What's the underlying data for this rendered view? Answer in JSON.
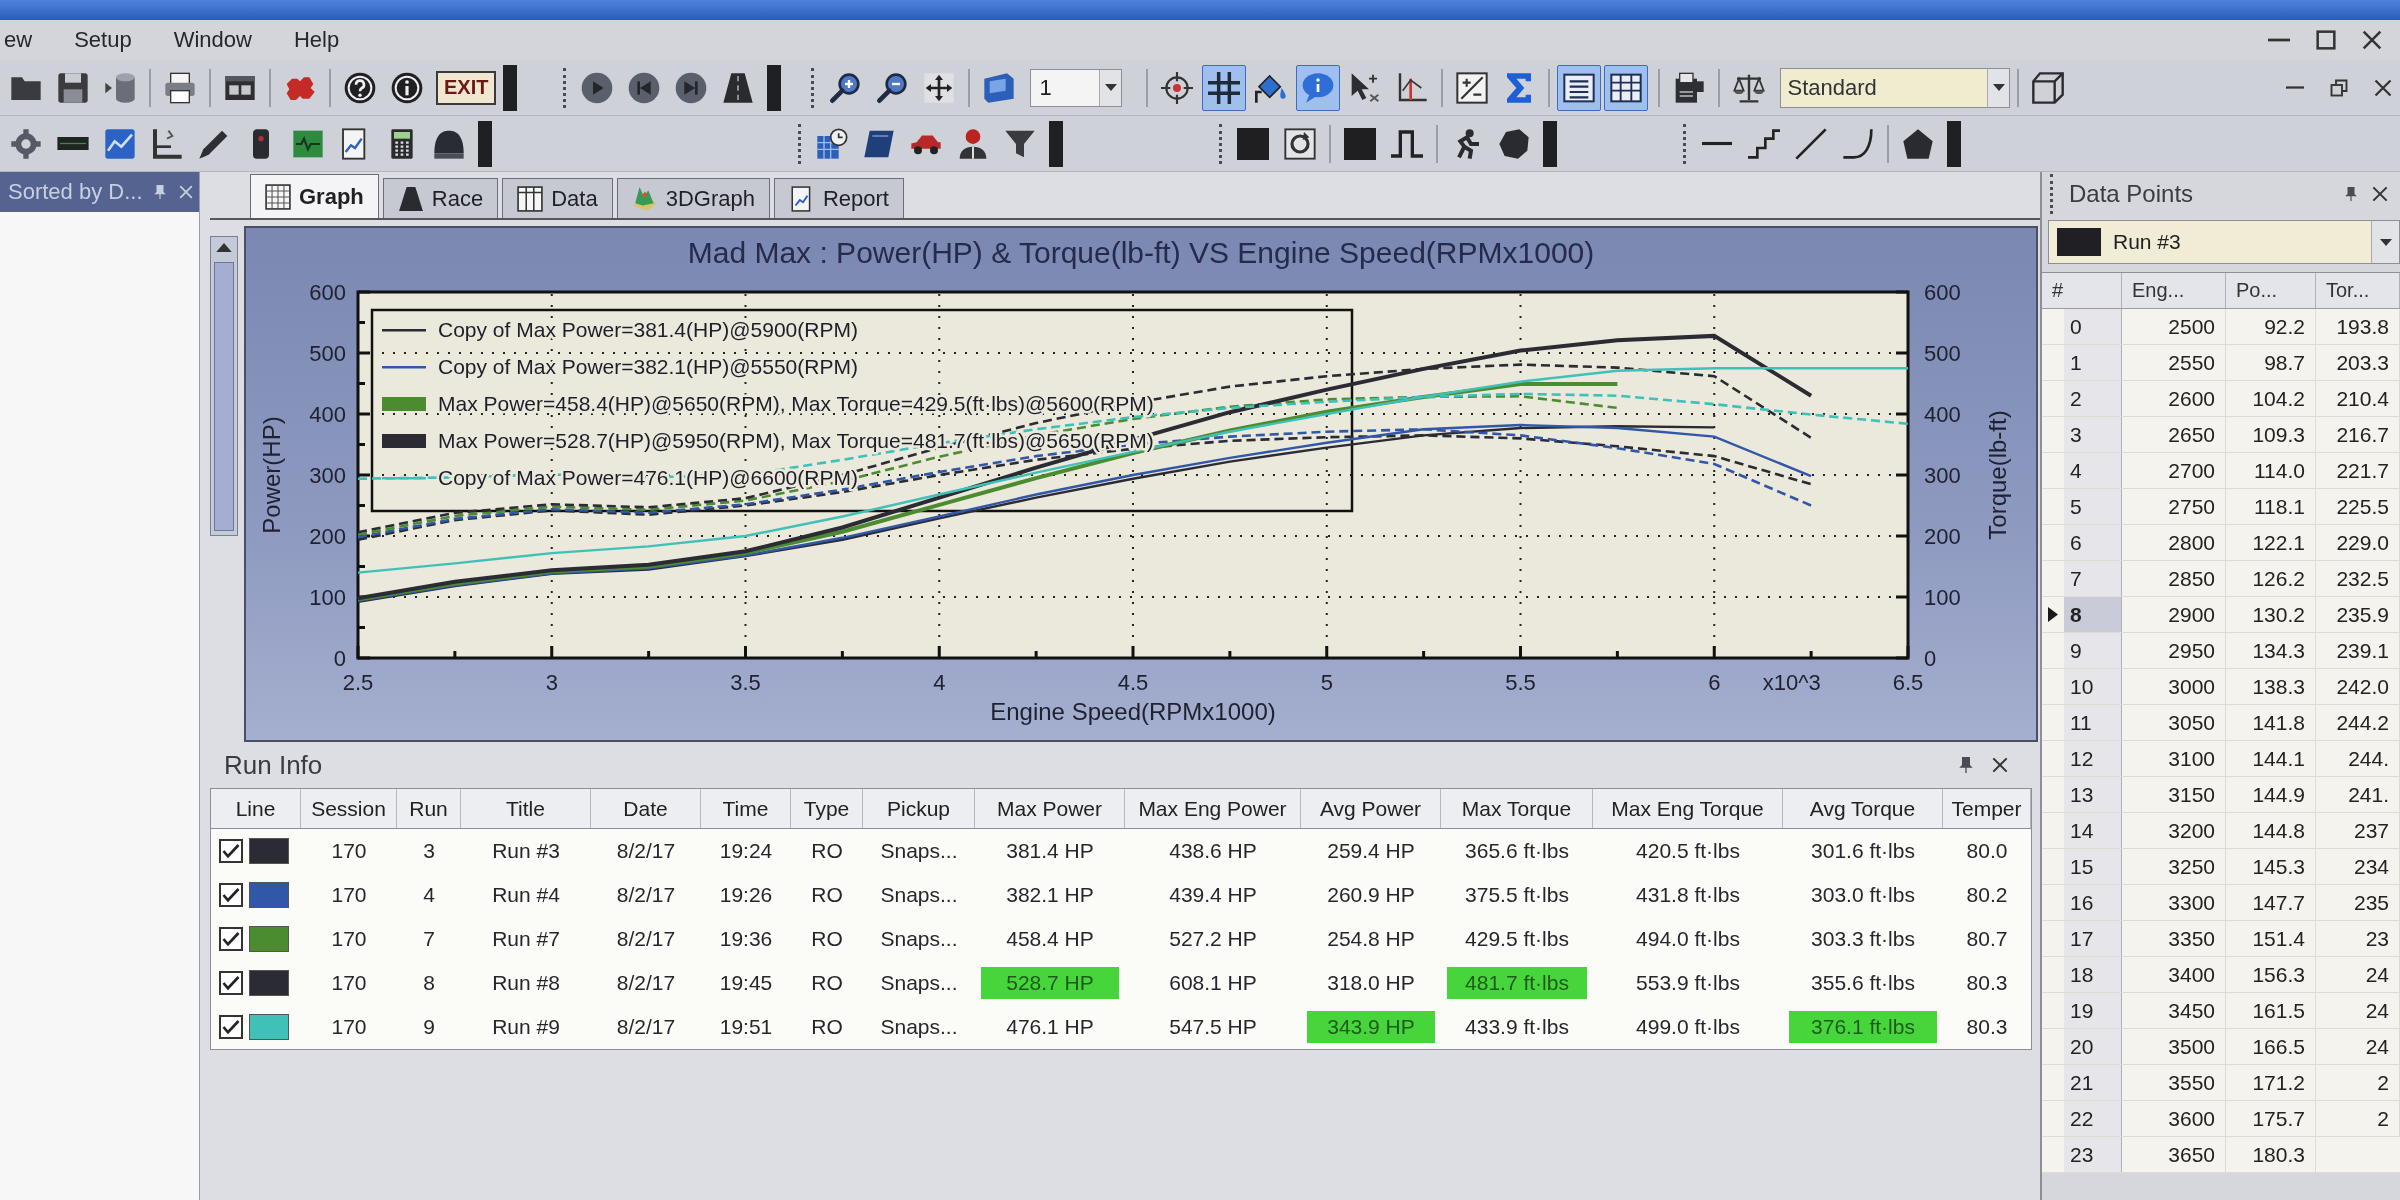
{
  "menu": [
    "ew",
    "Setup",
    "Window",
    "Help"
  ],
  "toolbar": {
    "exit_label": "EXIT",
    "step_value": "1",
    "view_toggles": [
      {
        "selected": false
      },
      {
        "selected": true
      },
      {
        "selected": false
      },
      {
        "selected": true
      },
      {
        "selected": false
      },
      {
        "selected": false
      },
      {
        "selected": false
      },
      {
        "selected": false
      },
      {
        "selected": true
      },
      {
        "selected": true
      }
    ],
    "mode_value": "Standard"
  },
  "side_panel": {
    "title": "Sorted by D..."
  },
  "tabs": [
    {
      "label": "Graph",
      "selected": true
    },
    {
      "label": "Race",
      "selected": false
    },
    {
      "label": "Data",
      "selected": false
    },
    {
      "label": "3DGraph",
      "selected": false
    },
    {
      "label": "Report",
      "selected": false
    }
  ],
  "graph": {
    "chart_data": {
      "type": "line",
      "title": "Mad Max : Power(HP) & Torque(lb-ft) VS Engine Speed(RPMx1000)",
      "xlabel": "Engine Speed(RPMx1000)",
      "ylabel": "Power(HP)",
      "x": [
        2.5,
        2.75,
        3,
        3.25,
        3.5,
        3.75,
        4,
        4.25,
        4.5,
        4.75,
        5,
        5.25,
        5.5,
        5.75,
        6,
        6.25,
        6.5
      ],
      "xlim": [
        2.5,
        6.5
      ],
      "ylim": [
        0,
        600
      ],
      "xticks": [
        2.5,
        3,
        3.5,
        4,
        4.5,
        5,
        5.5,
        6,
        6.5
      ],
      "yticks": [
        0,
        100,
        200,
        300,
        400,
        500,
        600
      ],
      "grid": true,
      "legend": "upper left",
      "series": [
        {
          "name": "Copy of Max Power=381.4(HP)@5900(RPM)",
          "color": "#2b2b33",
          "line_style": "solid",
          "values": [
            92,
            118,
            138,
            145,
            167,
            194,
            229,
            263,
            294,
            322,
            345,
            365,
            377,
            380,
            378,
            null,
            null
          ]
        },
        {
          "color": "#2b2b33",
          "line_style": "dashed",
          "values": [
            194,
            226,
            242,
            235,
            250,
            272,
            300,
            325,
            343,
            356,
            362,
            365,
            360,
            347,
            331,
            285,
            null
          ]
        },
        {
          "name": "Copy of Max Power=382.1(HP)@5550(RPM)",
          "color": "#3157a8",
          "line_style": "solid",
          "values": [
            94,
            119,
            139,
            147,
            168,
            197,
            232,
            268,
            300,
            328,
            353,
            375,
            382,
            377,
            363,
            298,
            null
          ]
        },
        {
          "color": "#3157a8",
          "line_style": "dashed",
          "values": [
            198,
            228,
            244,
            238,
            252,
            276,
            305,
            331,
            350,
            363,
            371,
            375,
            365,
            344,
            318,
            250,
            null
          ]
        },
        {
          "name": "Max Power=458.4(HP)@5650(RPM), Max Torque=429.5(ft·lbs)@5600(RPM)",
          "color": "#4c8c30",
          "line_style": "solid",
          "values": [
            96,
            122,
            142,
            150,
            172,
            207,
            251,
            295,
            336,
            373,
            404,
            428,
            449,
            449,
            null,
            null,
            null
          ]
        },
        {
          "color": "#4c8c30",
          "line_style": "dashed",
          "values": [
            202,
            233,
            248,
            243,
            258,
            290,
            330,
            365,
            392,
            412,
            424,
            428,
            429,
            410,
            null,
            null,
            null
          ]
        },
        {
          "name": "Max Power=528.7(HP)@5950(RPM), Max Torque=481.7(ft·lbs)@5650(RPM)",
          "color": "#2b2b33",
          "line_style": "solid",
          "values": [
            98,
            125,
            144,
            153,
            175,
            214,
            263,
            312,
            358,
            403,
            440,
            474,
            504,
            521,
            528,
            430,
            null
          ]
        },
        {
          "color": "#2b2b33",
          "line_style": "dashed",
          "values": [
            206,
            238,
            252,
            247,
            262,
            300,
            345,
            385,
            418,
            445,
            462,
            474,
            481,
            476,
            462,
            361,
            null
          ]
        },
        {
          "name": "Copy of Max Power=476.1(HP)@6600(RPM)",
          "color": "#3fc1b8",
          "line_style": "solid",
          "values": [
            140,
            155,
            172,
            183,
            200,
            232,
            268,
            304,
            338,
            371,
            400,
            428,
            453,
            471,
            475,
            475,
            475
          ]
        },
        {
          "color": "#3fc1b8",
          "line_style": "dashed",
          "values": [
            294,
            296,
            301,
            296,
            300,
            325,
            352,
            375,
            395,
            410,
            420,
            428,
            433,
            430,
            416,
            399,
            384
          ]
        }
      ]
    },
    "legend_entries": [
      {
        "kind": "line"
      },
      {
        "kind": "line"
      },
      {
        "kind": "block"
      },
      {
        "kind": "block"
      },
      {
        "kind": "line"
      }
    ],
    "right_axis": {
      "label": "Torque(lb-ft)",
      "ticks": [
        "600",
        "500",
        "400",
        "300",
        "200",
        "100",
        "0"
      ]
    },
    "x_multiplier": "x10^3"
  },
  "run_info": {
    "title": "Run Info",
    "columns": [
      "Line",
      "Session",
      "Run",
      "Title",
      "Date",
      "Time",
      "Type",
      "Pickup",
      "Max Power",
      "Max Eng Power",
      "Avg Power",
      "Max Torque",
      "Max Eng Torque",
      "Avg Torque",
      "Temper"
    ],
    "rows": [
      {
        "cells": [
          {
            "kind": "line",
            "checked": true,
            "color": "#2b2b33"
          },
          {
            "kind": "text",
            "text": "170",
            "highlighted": false
          },
          {
            "kind": "text",
            "text": "3",
            "highlighted": false
          },
          {
            "kind": "text",
            "text": "Run #3",
            "highlighted": false
          },
          {
            "kind": "text",
            "text": "8/2/17",
            "highlighted": false
          },
          {
            "kind": "text",
            "text": "19:24",
            "highlighted": false
          },
          {
            "kind": "text",
            "text": "RO",
            "highlighted": false
          },
          {
            "kind": "text",
            "text": "Snaps...",
            "highlighted": false
          },
          {
            "kind": "text",
            "text": "381.4 HP",
            "highlighted": false
          },
          {
            "kind": "text",
            "text": "438.6 HP",
            "highlighted": false
          },
          {
            "kind": "text",
            "text": "259.4 HP",
            "highlighted": false
          },
          {
            "kind": "text",
            "text": "365.6 ft·lbs",
            "highlighted": false
          },
          {
            "kind": "text",
            "text": "420.5 ft·lbs",
            "highlighted": false
          },
          {
            "kind": "text",
            "text": "301.6 ft·lbs",
            "highlighted": false
          },
          {
            "kind": "text",
            "text": "80.0",
            "highlighted": false
          }
        ]
      },
      {
        "cells": [
          {
            "kind": "line",
            "checked": true,
            "color": "#3157a8"
          },
          {
            "kind": "text",
            "text": "170",
            "highlighted": false
          },
          {
            "kind": "text",
            "text": "4",
            "highlighted": false
          },
          {
            "kind": "text",
            "text": "Run #4",
            "highlighted": false
          },
          {
            "kind": "text",
            "text": "8/2/17",
            "highlighted": false
          },
          {
            "kind": "text",
            "text": "19:26",
            "highlighted": false
          },
          {
            "kind": "text",
            "text": "RO",
            "highlighted": false
          },
          {
            "kind": "text",
            "text": "Snaps...",
            "highlighted": false
          },
          {
            "kind": "text",
            "text": "382.1 HP",
            "highlighted": false
          },
          {
            "kind": "text",
            "text": "439.4 HP",
            "highlighted": false
          },
          {
            "kind": "text",
            "text": "260.9 HP",
            "highlighted": false
          },
          {
            "kind": "text",
            "text": "375.5 ft·lbs",
            "highlighted": false
          },
          {
            "kind": "text",
            "text": "431.8 ft·lbs",
            "highlighted": false
          },
          {
            "kind": "text",
            "text": "303.0 ft·lbs",
            "highlighted": false
          },
          {
            "kind": "text",
            "text": "80.2",
            "highlighted": false
          }
        ]
      },
      {
        "cells": [
          {
            "kind": "line",
            "checked": true,
            "color": "#4c8c30"
          },
          {
            "kind": "text",
            "text": "170",
            "highlighted": false
          },
          {
            "kind": "text",
            "text": "7",
            "highlighted": false
          },
          {
            "kind": "text",
            "text": "Run #7",
            "highlighted": false
          },
          {
            "kind": "text",
            "text": "8/2/17",
            "highlighted": false
          },
          {
            "kind": "text",
            "text": "19:36",
            "highlighted": false
          },
          {
            "kind": "text",
            "text": "RO",
            "highlighted": false
          },
          {
            "kind": "text",
            "text": "Snaps...",
            "highlighted": false
          },
          {
            "kind": "text",
            "text": "458.4 HP",
            "highlighted": false
          },
          {
            "kind": "text",
            "text": "527.2 HP",
            "highlighted": false
          },
          {
            "kind": "text",
            "text": "254.8 HP",
            "highlighted": false
          },
          {
            "kind": "text",
            "text": "429.5 ft·lbs",
            "highlighted": false
          },
          {
            "kind": "text",
            "text": "494.0 ft·lbs",
            "highlighted": false
          },
          {
            "kind": "text",
            "text": "303.3 ft·lbs",
            "highlighted": false
          },
          {
            "kind": "text",
            "text": "80.7",
            "highlighted": false
          }
        ]
      },
      {
        "cells": [
          {
            "kind": "line",
            "checked": true,
            "color": "#2b2b33"
          },
          {
            "kind": "text",
            "text": "170",
            "highlighted": false
          },
          {
            "kind": "text",
            "text": "8",
            "highlighted": false
          },
          {
            "kind": "text",
            "text": "Run #8",
            "highlighted": false
          },
          {
            "kind": "text",
            "text": "8/2/17",
            "highlighted": false
          },
          {
            "kind": "text",
            "text": "19:45",
            "highlighted": false
          },
          {
            "kind": "text",
            "text": "RO",
            "highlighted": false
          },
          {
            "kind": "text",
            "text": "Snaps...",
            "highlighted": false
          },
          {
            "kind": "text",
            "text": "528.7 HP",
            "highlighted": true
          },
          {
            "kind": "text",
            "text": "608.1 HP",
            "highlighted": false
          },
          {
            "kind": "text",
            "text": "318.0 HP",
            "highlighted": false
          },
          {
            "kind": "text",
            "text": "481.7 ft·lbs",
            "highlighted": true
          },
          {
            "kind": "text",
            "text": "553.9 ft·lbs",
            "highlighted": false
          },
          {
            "kind": "text",
            "text": "355.6 ft·lbs",
            "highlighted": false
          },
          {
            "kind": "text",
            "text": "80.3",
            "highlighted": false
          }
        ]
      },
      {
        "cells": [
          {
            "kind": "line",
            "checked": true,
            "color": "#3fc1b8"
          },
          {
            "kind": "text",
            "text": "170",
            "highlighted": false
          },
          {
            "kind": "text",
            "text": "9",
            "highlighted": false
          },
          {
            "kind": "text",
            "text": "Run #9",
            "highlighted": false
          },
          {
            "kind": "text",
            "text": "8/2/17",
            "highlighted": false
          },
          {
            "kind": "text",
            "text": "19:51",
            "highlighted": false
          },
          {
            "kind": "text",
            "text": "RO",
            "highlighted": false
          },
          {
            "kind": "text",
            "text": "Snaps...",
            "highlighted": false
          },
          {
            "kind": "text",
            "text": "476.1 HP",
            "highlighted": false
          },
          {
            "kind": "text",
            "text": "547.5 HP",
            "highlighted": false
          },
          {
            "kind": "text",
            "text": "343.9 HP",
            "highlighted": true
          },
          {
            "kind": "text",
            "text": "433.9 ft·lbs",
            "highlighted": false
          },
          {
            "kind": "text",
            "text": "499.0 ft·lbs",
            "highlighted": false
          },
          {
            "kind": "text",
            "text": "376.1 ft·lbs",
            "highlighted": true
          },
          {
            "kind": "text",
            "text": "80.3",
            "highlighted": false
          }
        ]
      }
    ]
  },
  "data_points": {
    "title": "Data Points",
    "run": "Run #3",
    "columns": [
      "#",
      "Eng...",
      "Po...",
      "Tor..."
    ],
    "rows": [
      {
        "current": false,
        "cells": [
          "0",
          "2500",
          "92.2",
          "193.8"
        ]
      },
      {
        "current": false,
        "cells": [
          "1",
          "2550",
          "98.7",
          "203.3"
        ]
      },
      {
        "current": false,
        "cells": [
          "2",
          "2600",
          "104.2",
          "210.4"
        ]
      },
      {
        "current": false,
        "cells": [
          "3",
          "2650",
          "109.3",
          "216.7"
        ]
      },
      {
        "current": false,
        "cells": [
          "4",
          "2700",
          "114.0",
          "221.7"
        ]
      },
      {
        "current": false,
        "cells": [
          "5",
          "2750",
          "118.1",
          "225.5"
        ]
      },
      {
        "current": false,
        "cells": [
          "6",
          "2800",
          "122.1",
          "229.0"
        ]
      },
      {
        "current": false,
        "cells": [
          "7",
          "2850",
          "126.2",
          "232.5"
        ]
      },
      {
        "current": true,
        "cells": [
          "8",
          "2900",
          "130.2",
          "235.9"
        ]
      },
      {
        "current": false,
        "cells": [
          "9",
          "2950",
          "134.3",
          "239.1"
        ]
      },
      {
        "current": false,
        "cells": [
          "10",
          "3000",
          "138.3",
          "242.0"
        ]
      },
      {
        "current": false,
        "cells": [
          "11",
          "3050",
          "141.8",
          "244.2"
        ]
      },
      {
        "current": false,
        "cells": [
          "12",
          "3100",
          "144.1",
          "244."
        ]
      },
      {
        "current": false,
        "cells": [
          "13",
          "3150",
          "144.9",
          "241."
        ]
      },
      {
        "current": false,
        "cells": [
          "14",
          "3200",
          "144.8",
          "237"
        ]
      },
      {
        "current": false,
        "cells": [
          "15",
          "3250",
          "145.3",
          "234"
        ]
      },
      {
        "current": false,
        "cells": [
          "16",
          "3300",
          "147.7",
          "235"
        ]
      },
      {
        "current": false,
        "cells": [
          "17",
          "3350",
          "151.4",
          "23"
        ]
      },
      {
        "current": false,
        "cells": [
          "18",
          "3400",
          "156.3",
          "24"
        ]
      },
      {
        "current": false,
        "cells": [
          "19",
          "3450",
          "161.5",
          "24"
        ]
      },
      {
        "current": false,
        "cells": [
          "20",
          "3500",
          "166.5",
          "24"
        ]
      },
      {
        "current": false,
        "cells": [
          "21",
          "3550",
          "171.2",
          "2"
        ]
      },
      {
        "current": false,
        "cells": [
          "22",
          "3600",
          "175.7",
          "2"
        ]
      },
      {
        "current": false,
        "cells": [
          "23",
          "3650",
          "180.3"
        ]
      }
    ]
  }
}
